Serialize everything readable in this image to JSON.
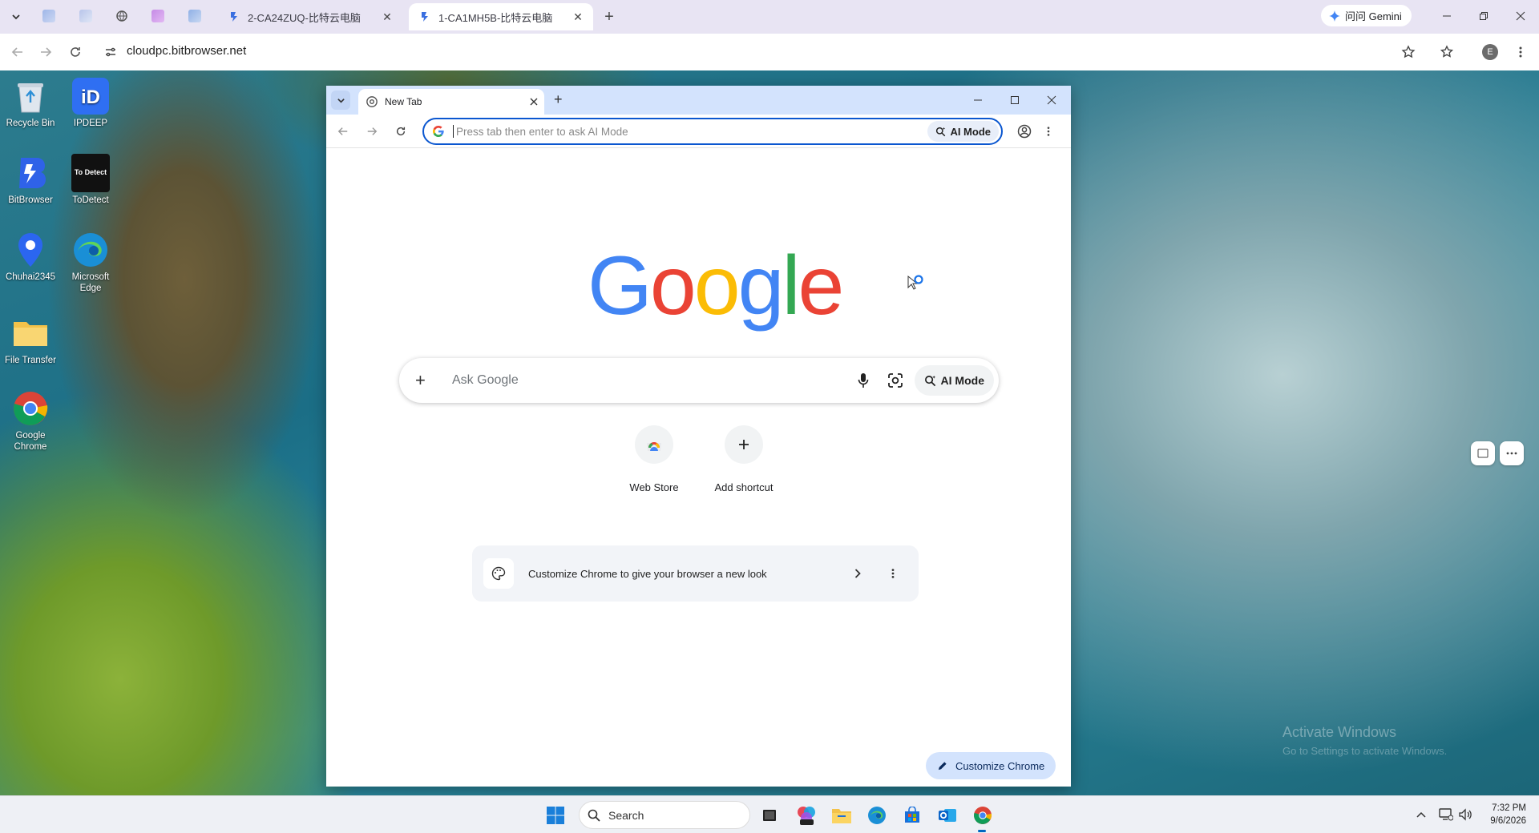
{
  "outer_browser": {
    "tabs": [
      {
        "title": "2-CA24ZUQ-比特云电脑",
        "active": false
      },
      {
        "title": "1-CA1MH5B-比特云电脑",
        "active": true
      }
    ],
    "gemini_label": "问问 Gemini",
    "url": "cloudpc.bitbrowser.net",
    "profile_initial": "E"
  },
  "desktop": {
    "icons": [
      {
        "label": "Recycle Bin"
      },
      {
        "label": "IPDEEP"
      },
      {
        "label": "BitBrowser"
      },
      {
        "label": "ToDetect"
      },
      {
        "label": "Chuhai2345"
      },
      {
        "label": "Microsoft Edge"
      },
      {
        "label": "File Transfer"
      },
      {
        "label": "Google Chrome"
      }
    ],
    "todetect_logo_text": "To Detect",
    "watermark_title": "Activate Windows",
    "watermark_sub": "Go to Settings to activate Windows."
  },
  "inner_browser": {
    "tab_title": "New Tab",
    "omnibox_placeholder": "Press tab then enter to ask AI Mode",
    "omnibox_ai_mode": "AI Mode",
    "ntp": {
      "logo_letters": [
        "G",
        "o",
        "o",
        "g",
        "l",
        "e"
      ],
      "search_placeholder": "Ask Google",
      "ai_mode_label": "AI Mode",
      "shortcuts": [
        {
          "label": "Web Store"
        },
        {
          "label": "Add shortcut"
        }
      ],
      "customize_card_text": "Customize Chrome to give your browser a new look",
      "customize_button": "Customize Chrome"
    }
  },
  "taskbar": {
    "search_label": "Search",
    "time": "7:32 PM",
    "date": "9/6/2026"
  },
  "colors": {
    "google_blue": "#4285F4",
    "google_red": "#EA4335",
    "google_yellow": "#FBBC05",
    "google_green": "#34A853",
    "accent": "#0b57d0"
  }
}
